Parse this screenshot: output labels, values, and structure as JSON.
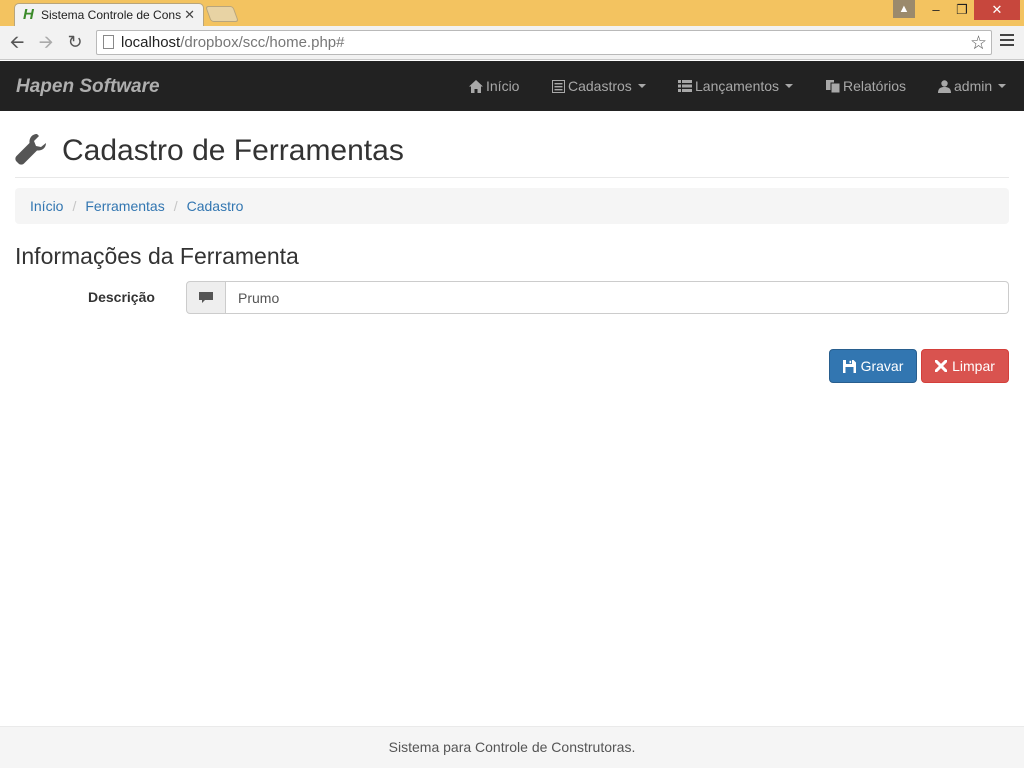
{
  "browser": {
    "tab_title": "Sistema Controle de Cons",
    "tab_favicon": "H",
    "url_host": "localhost",
    "url_path": "/dropbox/scc/home.php#",
    "window_controls": {
      "minimize": "–",
      "restore": "❐",
      "close": "✕"
    }
  },
  "navbar": {
    "brand": "Hapen Software",
    "items": [
      {
        "label": "Início",
        "icon": "home-icon"
      },
      {
        "label": "Cadastros",
        "icon": "list-alt-icon",
        "dropdown": true
      },
      {
        "label": "Lançamentos",
        "icon": "th-list-icon",
        "dropdown": true
      },
      {
        "label": "Relatórios",
        "icon": "copy-icon"
      },
      {
        "label": "admin",
        "icon": "user-icon",
        "dropdown": true
      }
    ]
  },
  "page": {
    "title": "Cadastro de Ferramentas",
    "title_icon": "wrench-icon",
    "breadcrumb": [
      "Início",
      "Ferramentas",
      "Cadastro"
    ],
    "breadcrumb_sep": "/",
    "section_title": "Informações da Ferramenta"
  },
  "form": {
    "description_label": "Descrição",
    "description_value": "Prumo",
    "description_icon": "comment-icon"
  },
  "actions": {
    "save_label": "Gravar",
    "clear_label": "Limpar"
  },
  "footer": {
    "text": "Sistema para Controle de Construtoras."
  },
  "colors": {
    "navbar": "#222222",
    "primary": "#3276b1",
    "danger": "#d9534f",
    "titlebar": "#f3c360"
  }
}
